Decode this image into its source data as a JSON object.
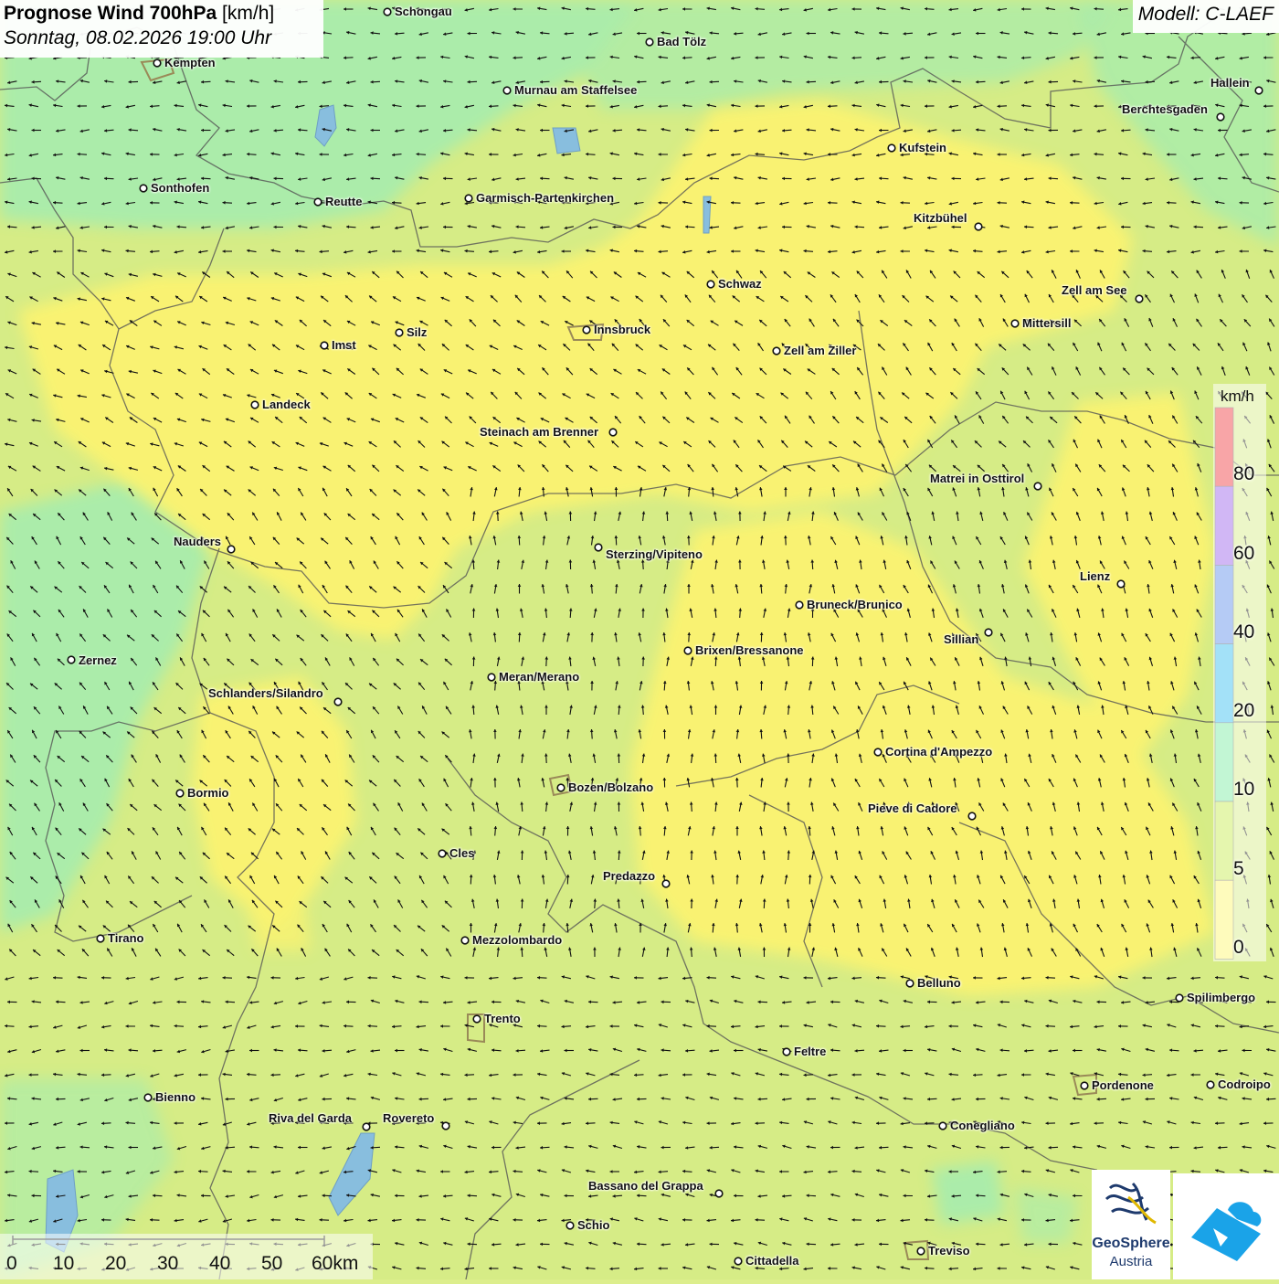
{
  "header": {
    "title_bold": "Prognose Wind 700hPa",
    "title_unit": "[km/h]",
    "datetime": "Sonntag, 08.02.2026 19:00 Uhr",
    "model": "Modell: C-LAEF"
  },
  "legend": {
    "unit": "km/h",
    "labels": [
      "80",
      "60",
      "40",
      "20",
      "10",
      "5",
      "0"
    ],
    "colors": [
      "#f0383c",
      "#9960e8",
      "#5b8ce8",
      "#33bdf0",
      "#79eca0",
      "#c6ec4c",
      "#fdf76a"
    ]
  },
  "scale_bar": {
    "labels": [
      "0",
      "10",
      "20",
      "30",
      "40",
      "50",
      "60km"
    ]
  },
  "cities": [
    {
      "name": "Schongau"
    },
    {
      "name": "Bad Tölz"
    },
    {
      "name": "Kempten"
    },
    {
      "name": "Hallein"
    },
    {
      "name": "Murnau am Staffelsee"
    },
    {
      "name": "Berchtesgaden"
    },
    {
      "name": "Kufstein"
    },
    {
      "name": "Sonthofen"
    },
    {
      "name": "Reutte"
    },
    {
      "name": "Garmisch-Partenkirchen"
    },
    {
      "name": "Kitzbühel"
    },
    {
      "name": "Schwaz"
    },
    {
      "name": "Zell am See"
    },
    {
      "name": "Mittersill"
    },
    {
      "name": "Innsbruck"
    },
    {
      "name": "Silz"
    },
    {
      "name": "Imst"
    },
    {
      "name": "Zell am Ziller"
    },
    {
      "name": "Landeck"
    },
    {
      "name": "Steinach am Brenner"
    },
    {
      "name": "Matrei in Osttirol"
    },
    {
      "name": "Nauders"
    },
    {
      "name": "Sterzing/Vipiteno"
    },
    {
      "name": "Lienz"
    },
    {
      "name": "Bruneck/Brunico"
    },
    {
      "name": "Sillian"
    },
    {
      "name": "Zernez"
    },
    {
      "name": "Brixen/Bressanone"
    },
    {
      "name": "Meran/Merano"
    },
    {
      "name": "Schlanders/Silandro"
    },
    {
      "name": "Cortina d'Ampezzo"
    },
    {
      "name": "Bozen/Bolzano"
    },
    {
      "name": "Bormio"
    },
    {
      "name": "Pieve di Cadore"
    },
    {
      "name": "Cles"
    },
    {
      "name": "Predazzo"
    },
    {
      "name": "Tirano"
    },
    {
      "name": "Mezzolombardo"
    },
    {
      "name": "Belluno"
    },
    {
      "name": "Spilimbergo"
    },
    {
      "name": "Trento"
    },
    {
      "name": "Feltre"
    },
    {
      "name": "Pordenone"
    },
    {
      "name": "Codroipo"
    },
    {
      "name": "Bienno"
    },
    {
      "name": "Riva del Garda"
    },
    {
      "name": "Rovereto"
    },
    {
      "name": "Conegliano"
    },
    {
      "name": "Bassano del Grappa"
    },
    {
      "name": "Schio"
    },
    {
      "name": "Treviso"
    },
    {
      "name": "Cittadella"
    }
  ],
  "logos": {
    "geosphere_line1": "GeoSphere",
    "geosphere_line2": "Austria"
  }
}
